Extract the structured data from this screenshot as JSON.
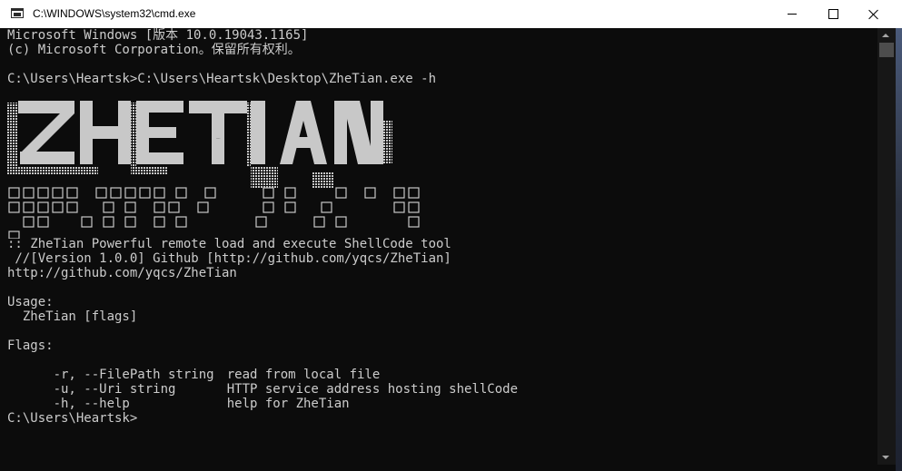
{
  "window": {
    "title": "C:\\WINDOWS\\system32\\cmd.exe",
    "icon": "console-icon",
    "controls": [
      "minimize-icon",
      "maximize-icon",
      "close-icon"
    ]
  },
  "console": {
    "header_lines": [
      "Microsoft Windows [版本 10.0.19043.1165]",
      "(c) Microsoft Corporation。保留所有权利。"
    ],
    "command_line": "C:\\Users\\Heartsk>C:\\Users\\Heartsk\\Desktop\\ZheTian.exe -h",
    "banner_text": "ZHETIAN",
    "banner_stray_glyph": "□",
    "tool_lines": [
      ":: ZheTian Powerful remote load and execute ShellCode tool",
      " //[Version 1.0.0] Github [http://github.com/yqcs/ZheTian]",
      "http://github.com/yqcs/ZheTian"
    ],
    "usage_title": "Usage:",
    "usage_line": "  ZheTian [flags]",
    "flags_title": "Flags:",
    "flags": [
      {
        "flag": "  -r, --FilePath string",
        "desc": "read from local file"
      },
      {
        "flag": "  -u, --Uri string",
        "desc": "HTTP service address hosting shellCode"
      },
      {
        "flag": "  -h, --help",
        "desc": "help for ZheTian"
      }
    ],
    "prompt": "C:\\Users\\Heartsk>"
  },
  "colors": {
    "background": "#0c0c0c",
    "text": "#cccccc",
    "banner_fill": "#c8c8c8",
    "titlebar": "#ffffff"
  }
}
